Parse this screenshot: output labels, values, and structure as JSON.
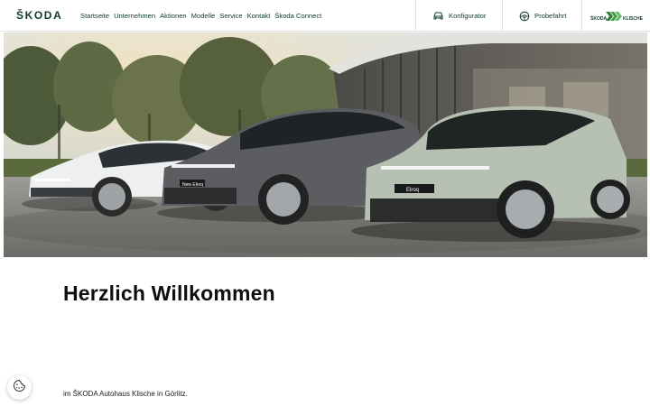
{
  "brand": {
    "logo_text": "ŠKODA",
    "accent": "#0e3a2f",
    "green": "#78faae"
  },
  "nav": {
    "items": [
      "Startseite",
      "Unternehmen",
      "Aktionen",
      "Modelle",
      "Service",
      "Kontakt",
      "Škoda Connect"
    ]
  },
  "header_actions": {
    "konfigurator": {
      "label": "Konfigurator",
      "icon": "car-icon"
    },
    "probefahrt": {
      "label": "Probefahrt",
      "icon": "steering-wheel-icon"
    }
  },
  "dealer_logo": {
    "text": "ŠKODA KLISCHE"
  },
  "hero": {
    "cars": [
      {
        "plate": "",
        "color": "#eef0f0"
      },
      {
        "plate": "New Elroq",
        "color": "#5b5d60"
      },
      {
        "plate": "Elroq",
        "color": "#b6c1b4"
      }
    ]
  },
  "main": {
    "headline": "Herzlich Willkommen",
    "subline": "im ŠKODA Autohaus Klische in Görlitz."
  },
  "cookie": {
    "icon": "cookie-icon"
  }
}
